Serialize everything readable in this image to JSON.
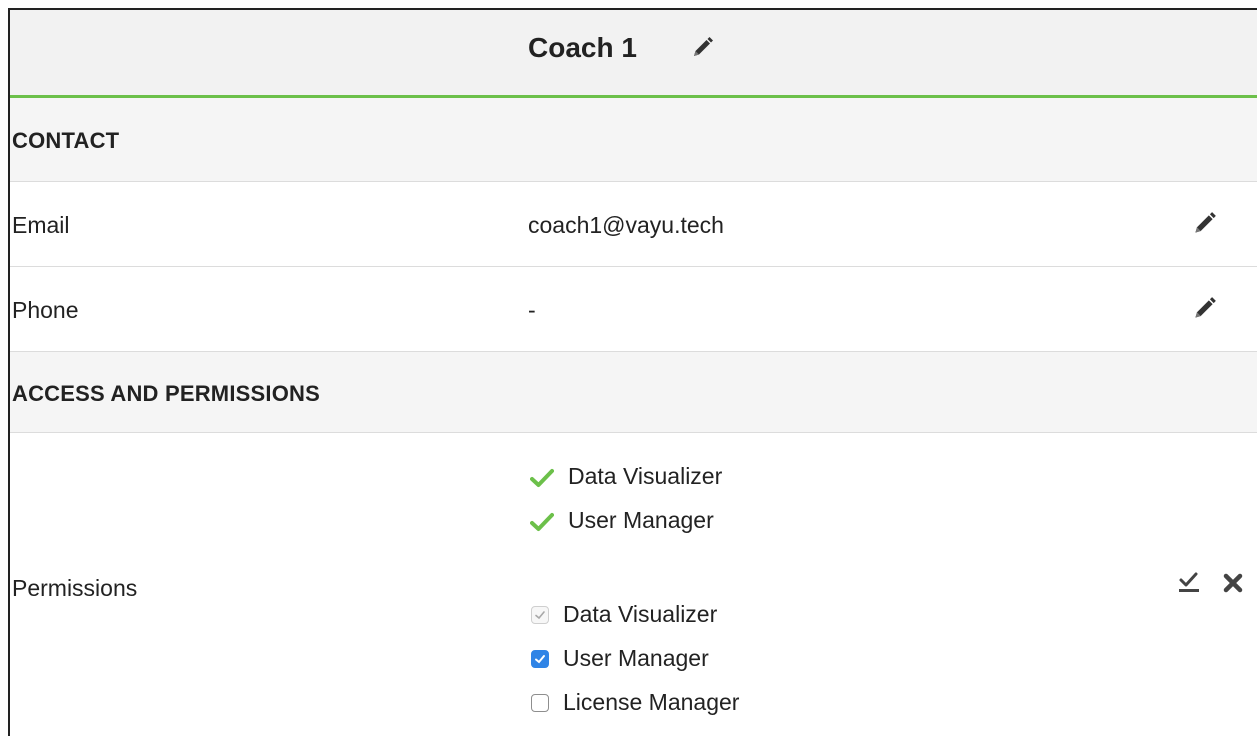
{
  "header": {
    "title": "Coach 1",
    "edit_icon": "pencil-icon"
  },
  "sections": {
    "contact": {
      "label": "CONTACT"
    },
    "access": {
      "label": "ACCESS AND PERMISSIONS"
    }
  },
  "fields": {
    "email": {
      "label": "Email",
      "value": "coach1@vayu.tech"
    },
    "phone": {
      "label": "Phone",
      "value": "-"
    },
    "permissions": {
      "label": "Permissions",
      "current": [
        {
          "label": "Data Visualizer",
          "icon": "check-icon"
        },
        {
          "label": "User Manager",
          "icon": "check-icon"
        }
      ],
      "options": [
        {
          "label": "Data Visualizer",
          "state": "checked-disabled"
        },
        {
          "label": "User Manager",
          "state": "checked"
        },
        {
          "label": "License Manager",
          "state": "unchecked"
        }
      ]
    }
  },
  "colors": {
    "accent_green": "#6cc04a",
    "checkbox_blue": "#2f84e6",
    "header_bg": "#f2f2f2",
    "section_bg": "#f5f5f5"
  }
}
